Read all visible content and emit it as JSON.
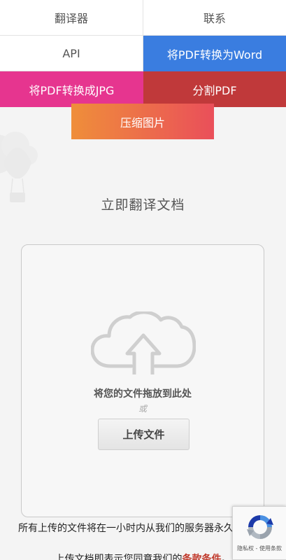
{
  "nav": {
    "translator": "翻译器",
    "contact": "联系",
    "api": "API",
    "pdf_to_word": "将PDF转换为Word",
    "pdf_to_jpg": "将PDF转换成JPG",
    "split_pdf": "分割PDF",
    "compress_image": "压缩图片"
  },
  "main": {
    "heading": "立即翻译文档",
    "drop_text": "将您的文件拖放到此处",
    "or_text": "或",
    "upload_button": "上传文件"
  },
  "footer": {
    "notice": "所有上传的文件将在一小时内从我们的服务器永久删除。",
    "agreement_prefix": "上传文档即表示您同意我们的",
    "terms_link": "条款条件",
    "agreement_suffix": "。"
  },
  "recaptcha": {
    "text": "隐私权 - 使用条款"
  },
  "colors": {
    "blue": "#3a7de0",
    "pink": "#e6358f",
    "red": "#c0393a",
    "orange_gradient_start": "#ef8e3a",
    "orange_gradient_end": "#ea4f5a",
    "terms_link": "#c0392b"
  },
  "icons": {
    "upload": "cloud-upload-icon",
    "recaptcha": "recaptcha-logo-icon",
    "decoration": "hot-air-balloon-icon"
  }
}
